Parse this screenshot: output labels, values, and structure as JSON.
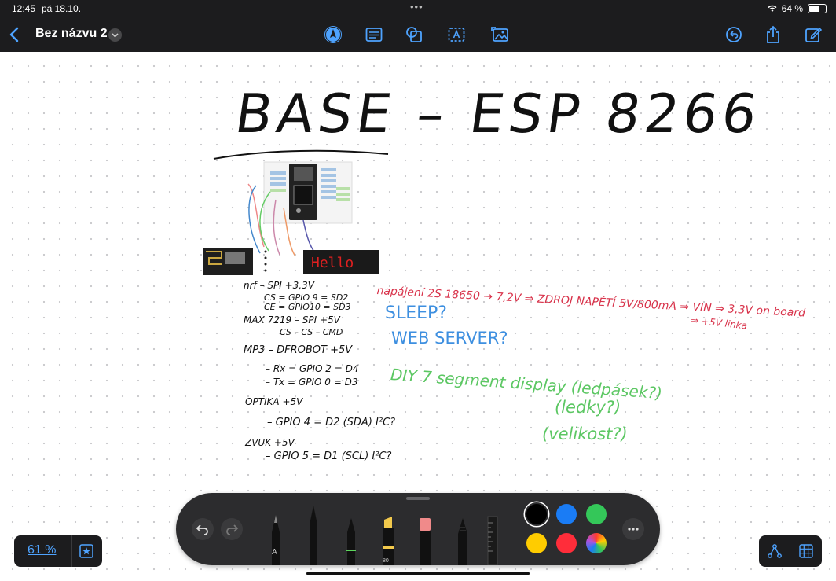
{
  "status": {
    "time": "12:45",
    "date": "pá 18.10.",
    "battery": "64 %"
  },
  "header": {
    "title": "Bez názvu 2"
  },
  "canvas": {
    "title": "BASE – ESP 8266",
    "notes_black": [
      "nrf – SPI   +3,3V",
      "CS = GPIO 9 = SD2",
      "CE = GPIO10 = SD3",
      "MAX 7219 – SPI +5V",
      "CS – CS – CMD",
      "MP3 – DFROBOT +5V",
      "– Rx = GPIO 2 = D4",
      "– Tx = GPIO 0 = D3",
      "OPTIKA +5V",
      "– GPIO 4 = D2 (SDA) I²C?",
      "ZVUK +5V",
      "– GPIO 5 = D1 (SCL) I²C?"
    ],
    "notes_red": [
      "napájení 2S 18650 → 7,2V ⇒ ZDROJ NAPĚTÍ 5V/800mA ⇒ VIN ⇒ 3,3V on board",
      "⇒ +5V linka"
    ],
    "notes_blue": [
      "SLEEP?",
      "WEB SERVER?"
    ],
    "notes_green": [
      "DIY 7 segment display (ledpásek?)",
      "(ledky?)",
      "(velikost?)"
    ],
    "display_text": "Hello"
  },
  "toolbar": {
    "pen_a_label": "A",
    "marker_size": "80",
    "colors": [
      "#000000",
      "#1a7cf5",
      "#34c759",
      "#ffcc00",
      "#ff2d3a",
      "multicolor"
    ]
  },
  "zoom": {
    "label": "61 %"
  },
  "icons": [
    "back-icon",
    "chevron-down-icon",
    "pen-icon",
    "text-icon",
    "shapes-icon",
    "textbox-icon",
    "image-icon",
    "undo-history-icon",
    "share-icon",
    "edit-icon",
    "undo-icon",
    "redo-icon",
    "more-icon",
    "star-icon",
    "network-icon",
    "grid-icon",
    "wifi-icon",
    "battery-icon"
  ]
}
